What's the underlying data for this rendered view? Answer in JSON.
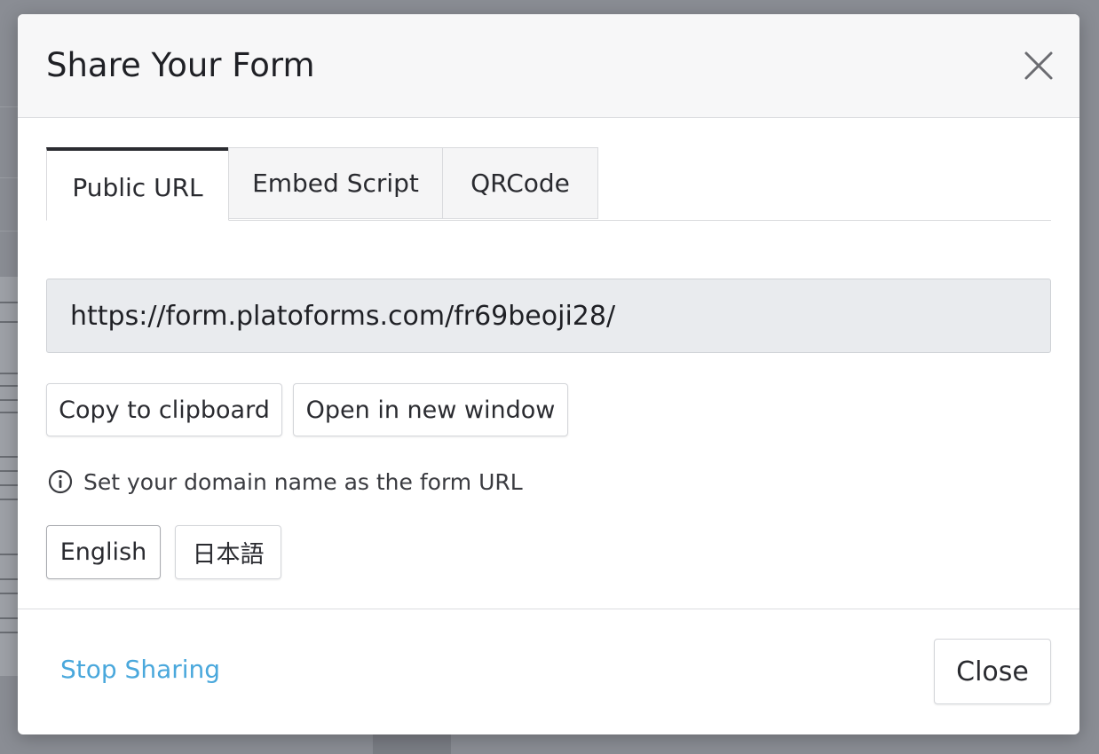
{
  "modal": {
    "title": "Share Your Form"
  },
  "tabs": [
    {
      "label": "Public URL",
      "active": true
    },
    {
      "label": "Embed Script",
      "active": false
    },
    {
      "label": "QRCode",
      "active": false
    }
  ],
  "public_url": {
    "value": "https://form.platoforms.com/fr69beoji28/"
  },
  "actions": {
    "copy_label": "Copy to clipboard",
    "open_label": "Open in new window"
  },
  "info": {
    "text": "Set your domain name as the form URL",
    "icon": "info-circle-icon"
  },
  "languages": [
    {
      "label": "English",
      "selected": true
    },
    {
      "label": "日本語",
      "selected": false
    }
  ],
  "footer": {
    "stop_sharing_label": "Stop Sharing",
    "close_label": "Close"
  },
  "colors": {
    "link": "#4aa8dc",
    "active_tab_border": "#2b2c31",
    "url_field_bg": "#e9ebee",
    "overlay": "#7d8088"
  }
}
